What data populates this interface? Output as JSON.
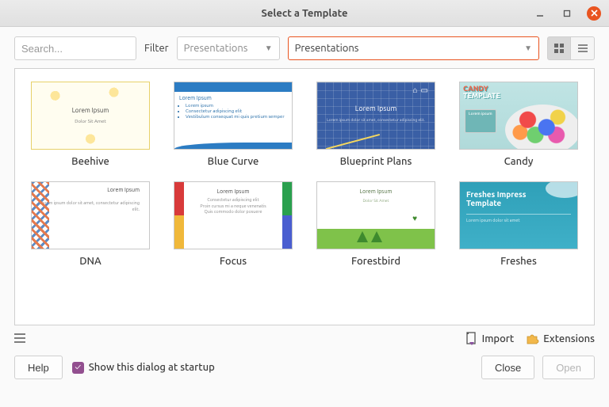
{
  "window": {
    "title": "Select a Template"
  },
  "toolbar": {
    "search_placeholder": "Search...",
    "filter_label": "Filter",
    "filter_combo": "Presentations",
    "category_combo": "Presentations"
  },
  "templates": [
    {
      "name": "Beehive"
    },
    {
      "name": "Blue Curve"
    },
    {
      "name": "Blueprint Plans"
    },
    {
      "name": "Candy"
    },
    {
      "name": "DNA"
    },
    {
      "name": "Focus"
    },
    {
      "name": "Forestbird"
    },
    {
      "name": "Freshes"
    }
  ],
  "thumb_text": {
    "lorem": "Lorem Ipsum",
    "dolor": "Dolor Sit Amet",
    "bullets1": "Lorem ipsum",
    "bullets2": "Consectetur adipiscing elit",
    "bullets3": "Vestibulum consequat mi quis pretium semper",
    "body_small": "Lorem ipsum dolor sit amet, consectetur adipiscing elit.",
    "body_small2": "Proin cursus mi a neque venenatis",
    "body_small3": "Quis commodo dolor posuere",
    "candy_label_a": "CANDY",
    "candy_label_b": "TEMPLATE",
    "candy_btn": "Lorem ipsum",
    "freshes_title": "Freshes Impress\nTemplate",
    "freshes_sub": "Lorem ipsum dolor sit amet"
  },
  "actions": {
    "import": "Import",
    "extensions": "Extensions"
  },
  "bottom": {
    "help": "Help",
    "startup": "Show this dialog at startup",
    "close": "Close",
    "open": "Open"
  },
  "state": {
    "startup_checked": true,
    "view_mode": "grid",
    "open_enabled": false
  },
  "colors": {
    "accent": "#e95420",
    "check": "#924f8f"
  }
}
